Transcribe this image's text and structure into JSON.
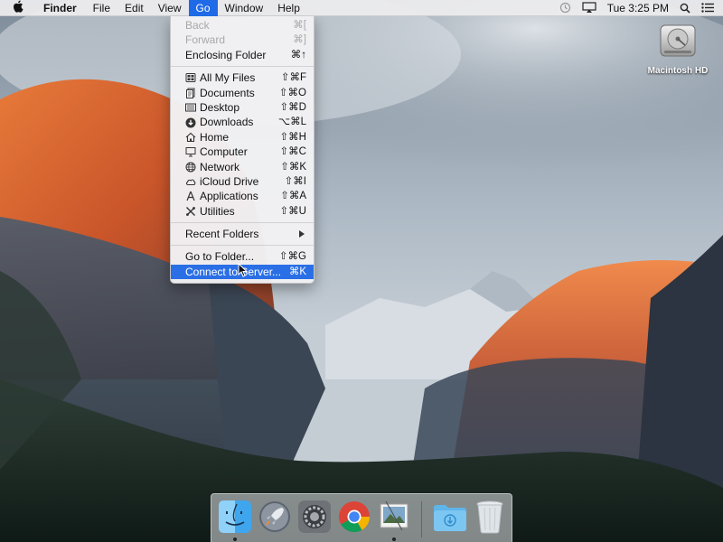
{
  "menubar": {
    "app_name": "Finder",
    "menus": [
      "File",
      "Edit",
      "View",
      "Go",
      "Window",
      "Help"
    ],
    "active_menu": "Go",
    "clock": "Tue 3:25 PM",
    "status_icons": [
      "time-machine-icon",
      "airplay-display-icon",
      "spotlight-search-icon",
      "notification-center-icon"
    ]
  },
  "go_menu": {
    "back": {
      "label": "Back",
      "shortcut": "⌘["
    },
    "forward": {
      "label": "Forward",
      "shortcut": "⌘]"
    },
    "enclosing": {
      "label": "Enclosing Folder",
      "shortcut": "⌘↑"
    },
    "places": [
      {
        "label": "All My Files",
        "shortcut": "⇧⌘F",
        "icon": "all-my-files-icon"
      },
      {
        "label": "Documents",
        "shortcut": "⇧⌘O",
        "icon": "documents-icon"
      },
      {
        "label": "Desktop",
        "shortcut": "⇧⌘D",
        "icon": "desktop-icon"
      },
      {
        "label": "Downloads",
        "shortcut": "⌥⌘L",
        "icon": "downloads-icon"
      },
      {
        "label": "Home",
        "shortcut": "⇧⌘H",
        "icon": "home-icon"
      },
      {
        "label": "Computer",
        "shortcut": "⇧⌘C",
        "icon": "computer-icon"
      },
      {
        "label": "Network",
        "shortcut": "⇧⌘K",
        "icon": "network-icon"
      },
      {
        "label": "iCloud Drive",
        "shortcut": "⇧⌘I",
        "icon": "icloud-drive-icon"
      },
      {
        "label": "Applications",
        "shortcut": "⇧⌘A",
        "icon": "applications-icon"
      },
      {
        "label": "Utilities",
        "shortcut": "⇧⌘U",
        "icon": "utilities-icon"
      }
    ],
    "recent": {
      "label": "Recent Folders"
    },
    "go_to_folder": {
      "label": "Go to Folder...",
      "shortcut": "⇧⌘G"
    },
    "connect": {
      "label": "Connect to Server...",
      "shortcut": "⌘K"
    }
  },
  "desktop": {
    "drive_label": "Macintosh HD"
  },
  "dock": {
    "items": [
      {
        "name": "finder",
        "running": true
      },
      {
        "name": "launchpad",
        "running": false
      },
      {
        "name": "system-preferences",
        "running": false
      },
      {
        "name": "chrome",
        "running": false
      },
      {
        "name": "preview",
        "running": true
      },
      {
        "name": "downloads-stack",
        "running": false
      },
      {
        "name": "trash",
        "running": false
      }
    ]
  },
  "colors": {
    "highlight": "#2a6fe5",
    "menubar_bg": "#ececee"
  }
}
